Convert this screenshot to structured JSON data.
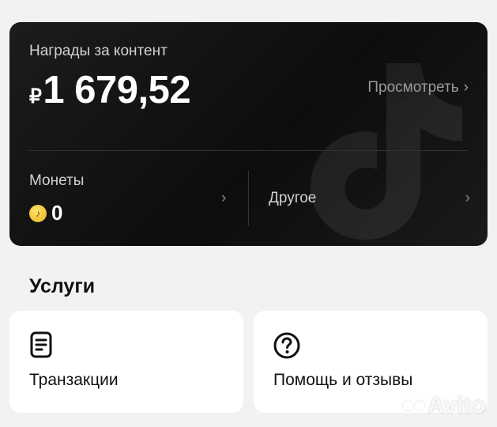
{
  "rewards_card": {
    "title": "Награды за контент",
    "currency_symbol": "₽",
    "amount": "1 679,52",
    "view_link": "Просмотреть",
    "chevron": "›",
    "coins_label": "Монеты",
    "coins_value": "0",
    "other_label": "Другое",
    "bg_icon": "tiktok-logo-icon"
  },
  "services": {
    "title": "Услуги",
    "items": [
      {
        "label": "Транзакции",
        "icon": "document-icon"
      },
      {
        "label": "Помощь и отзывы",
        "icon": "question-circle-icon"
      }
    ]
  },
  "watermark": {
    "text": "Avito"
  },
  "colors": {
    "card_bg": "#111111",
    "page_bg": "#f2f2f4",
    "coin": "#f2c230"
  }
}
